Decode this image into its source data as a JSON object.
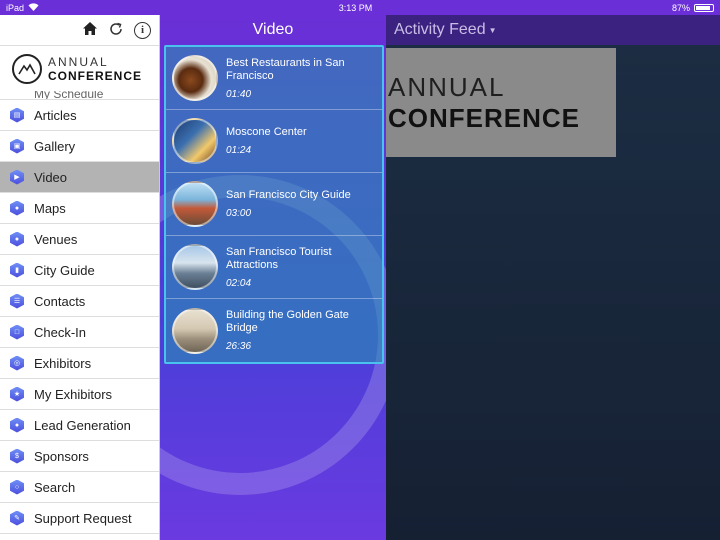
{
  "status": {
    "device": "iPad",
    "time": "3:13 PM",
    "battery": "87%"
  },
  "activity": {
    "title": "Activity Feed"
  },
  "banner": {
    "line1": "ANNUAL",
    "line2": "CONFERENCE"
  },
  "logo": {
    "line1": "ANNUAL",
    "line2": "CONFERENCE"
  },
  "video": {
    "title": "Video",
    "items": [
      {
        "title": "Best Restaurants in San Francisco",
        "duration": "01:40"
      },
      {
        "title": "Moscone Center",
        "duration": "01:24"
      },
      {
        "title": "San Francisco City Guide",
        "duration": "03:00"
      },
      {
        "title": "San Francisco Tourist Attractions",
        "duration": "02:04"
      },
      {
        "title": "Building the Golden Gate Bridge",
        "duration": "26:36"
      }
    ]
  },
  "sidebar": {
    "partial_label": "My Schedule",
    "items": [
      {
        "label": "Articles",
        "icon": "articles-icon"
      },
      {
        "label": "Gallery",
        "icon": "gallery-icon"
      },
      {
        "label": "Video",
        "icon": "video-icon",
        "active": true
      },
      {
        "label": "Maps",
        "icon": "maps-icon"
      },
      {
        "label": "Venues",
        "icon": "venues-icon"
      },
      {
        "label": "City Guide",
        "icon": "city-guide-icon"
      },
      {
        "label": "Contacts",
        "icon": "contacts-icon"
      },
      {
        "label": "Check-In",
        "icon": "check-in-icon"
      },
      {
        "label": "Exhibitors",
        "icon": "exhibitors-icon"
      },
      {
        "label": "My Exhibitors",
        "icon": "my-exhibitors-icon"
      },
      {
        "label": "Lead Generation",
        "icon": "lead-generation-icon"
      },
      {
        "label": "Sponsors",
        "icon": "sponsors-icon"
      },
      {
        "label": "Search",
        "icon": "search-icon"
      },
      {
        "label": "Support Request",
        "icon": "support-request-icon"
      }
    ]
  }
}
